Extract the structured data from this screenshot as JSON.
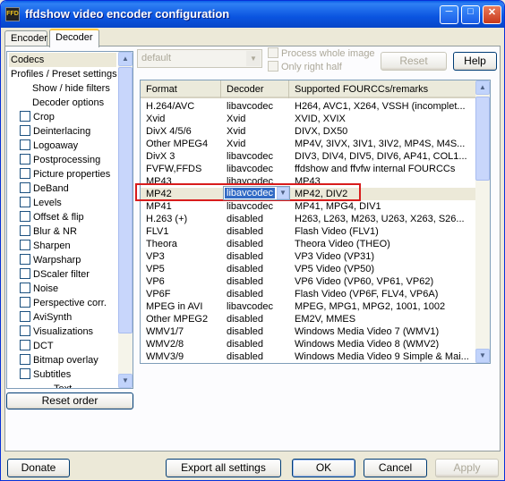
{
  "window": {
    "title": "ffdshow video encoder configuration",
    "icon_text": "FFD"
  },
  "tabs": [
    {
      "label": "Encoder"
    },
    {
      "label": "Decoder"
    }
  ],
  "tree": {
    "items": [
      {
        "label": "Codecs",
        "checkbox": false,
        "indent": 0,
        "selected": true
      },
      {
        "label": "Profiles / Preset settings",
        "checkbox": false,
        "indent": 0
      },
      {
        "label": "Show / hide filters",
        "checkbox": false,
        "indent": 1
      },
      {
        "label": "Decoder options",
        "checkbox": false,
        "indent": 1
      },
      {
        "label": "Crop",
        "checkbox": true
      },
      {
        "label": "Deinterlacing",
        "checkbox": true
      },
      {
        "label": "Logoaway",
        "checkbox": true
      },
      {
        "label": "Postprocessing",
        "checkbox": true
      },
      {
        "label": "Picture properties",
        "checkbox": true
      },
      {
        "label": "DeBand",
        "checkbox": true
      },
      {
        "label": "Levels",
        "checkbox": true
      },
      {
        "label": "Offset & flip",
        "checkbox": true
      },
      {
        "label": "Blur & NR",
        "checkbox": true
      },
      {
        "label": "Sharpen",
        "checkbox": true
      },
      {
        "label": "Warpsharp",
        "checkbox": true
      },
      {
        "label": "DScaler filter",
        "checkbox": true
      },
      {
        "label": "Noise",
        "checkbox": true
      },
      {
        "label": "Perspective corr.",
        "checkbox": true
      },
      {
        "label": "AviSynth",
        "checkbox": true
      },
      {
        "label": "Visualizations",
        "checkbox": true
      },
      {
        "label": "DCT",
        "checkbox": true
      },
      {
        "label": "Bitmap overlay",
        "checkbox": true
      },
      {
        "label": "Subtitles",
        "checkbox": true
      },
      {
        "label": "Text",
        "checkbox": false,
        "indent": 2
      }
    ]
  },
  "top_controls": {
    "preset_combo_value": "default",
    "process_whole_image_label": "Process whole image",
    "only_right_half_label": "Only right half",
    "reset_label": "Reset",
    "help_label": "Help"
  },
  "codec_list": {
    "headers": [
      "Format",
      "Decoder",
      "Supported FOURCCs/remarks"
    ],
    "rows": [
      [
        "H.264/AVC",
        "libavcodec",
        "H264, AVC1, X264, VSSH (incomplet..."
      ],
      [
        "Xvid",
        "Xvid",
        "XVID, XVIX"
      ],
      [
        "DivX 4/5/6",
        "Xvid",
        "DIVX, DX50"
      ],
      [
        "Other MPEG4",
        "Xvid",
        "MP4V, 3IVX, 3IV1, 3IV2, MP4S, M4S..."
      ],
      [
        "DivX 3",
        "libavcodec",
        "DIV3, DIV4, DIV5, DIV6, AP41, COL1..."
      ],
      [
        "FVFW,FFDS",
        "libavcodec",
        "ffdshow and ffvfw internal FOURCCs"
      ],
      [
        "MP43",
        "libavcodec",
        "MP43"
      ],
      [
        "MP42",
        "libavcodec",
        "MP42, DIV2"
      ],
      [
        "MP41",
        "libavcodec",
        "MP41, MPG4, DIV1"
      ],
      [
        "H.263 (+)",
        "disabled",
        "H263, L263, M263, U263, X263, S26..."
      ],
      [
        "FLV1",
        "disabled",
        "Flash Video (FLV1)"
      ],
      [
        "Theora",
        "disabled",
        "Theora Video (THEO)"
      ],
      [
        "VP3",
        "disabled",
        "VP3 Video (VP31)"
      ],
      [
        "VP5",
        "disabled",
        "VP5 Video (VP50)"
      ],
      [
        "VP6",
        "disabled",
        "VP6 Video (VP60, VP61, VP62)"
      ],
      [
        "VP6F",
        "disabled",
        "Flash Video (VP6F, FLV4, VP6A)"
      ],
      [
        "MPEG in AVI",
        "libavcodec",
        "MPEG, MPG1, MPG2, 1001, 1002"
      ],
      [
        "Other MPEG2",
        "disabled",
        "EM2V, MMES"
      ],
      [
        "WMV1/7",
        "disabled",
        "Windows Media Video 7 (WMV1)"
      ],
      [
        "WMV2/8",
        "disabled",
        "Windows Media Video 8 (WMV2)"
      ],
      [
        "WMV3/9",
        "disabled",
        "Windows Media Video 9 Simple & Mai..."
      ]
    ],
    "selected_dropdown_value": "libavcodec"
  },
  "buttons": {
    "reset_order": "Reset order",
    "donate": "Donate",
    "export_all": "Export all settings",
    "ok": "OK",
    "cancel": "Cancel",
    "apply": "Apply"
  }
}
